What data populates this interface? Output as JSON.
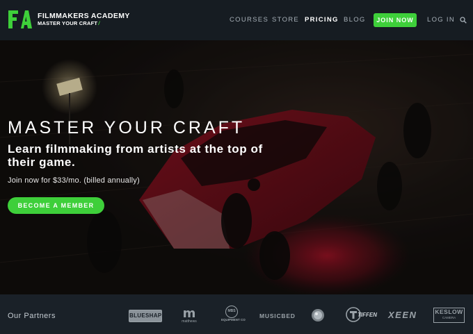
{
  "nav": {
    "brand": "FILMMAKERS ACADEMY",
    "tagline": "MASTER YOUR CRAFT",
    "links": [
      "COURSES",
      "STORE",
      "PRICING",
      "BLOG"
    ],
    "join_label": "JOIN NOW",
    "login_label": "LOG IN"
  },
  "hero": {
    "title": "MASTER YOUR CRAFT",
    "subtitle": "Learn filmmaking from artists at the top of their game.",
    "price_text": "Join now for $33/mo. (billed annually)",
    "cta_label": "BECOME A MEMBER"
  },
  "partners": {
    "label": "Our Partners",
    "logos": [
      "BLUESHAPE",
      "matthews",
      "MBS EQUIPMENT CO",
      "MUSICBED",
      "",
      "TIFFEN",
      "XEEN",
      "KESLOW CAMERA"
    ],
    "logo_text": {
      "blueshape": "BLUESHAPE",
      "matthews": "m",
      "matthews_sub": "matthews",
      "mbs": "MBS",
      "mbs_sub": "EQUIPMENT CO",
      "musicbed": "MUSICBED",
      "tiffen": "TIFFEN",
      "xeen": "XEEN",
      "keslow": "KESLOW",
      "keslow_sub": "CAMERA"
    }
  },
  "colors": {
    "accent": "#3ecf3a",
    "nav_bg": "#161c22",
    "partners_bg": "#1a2128"
  }
}
